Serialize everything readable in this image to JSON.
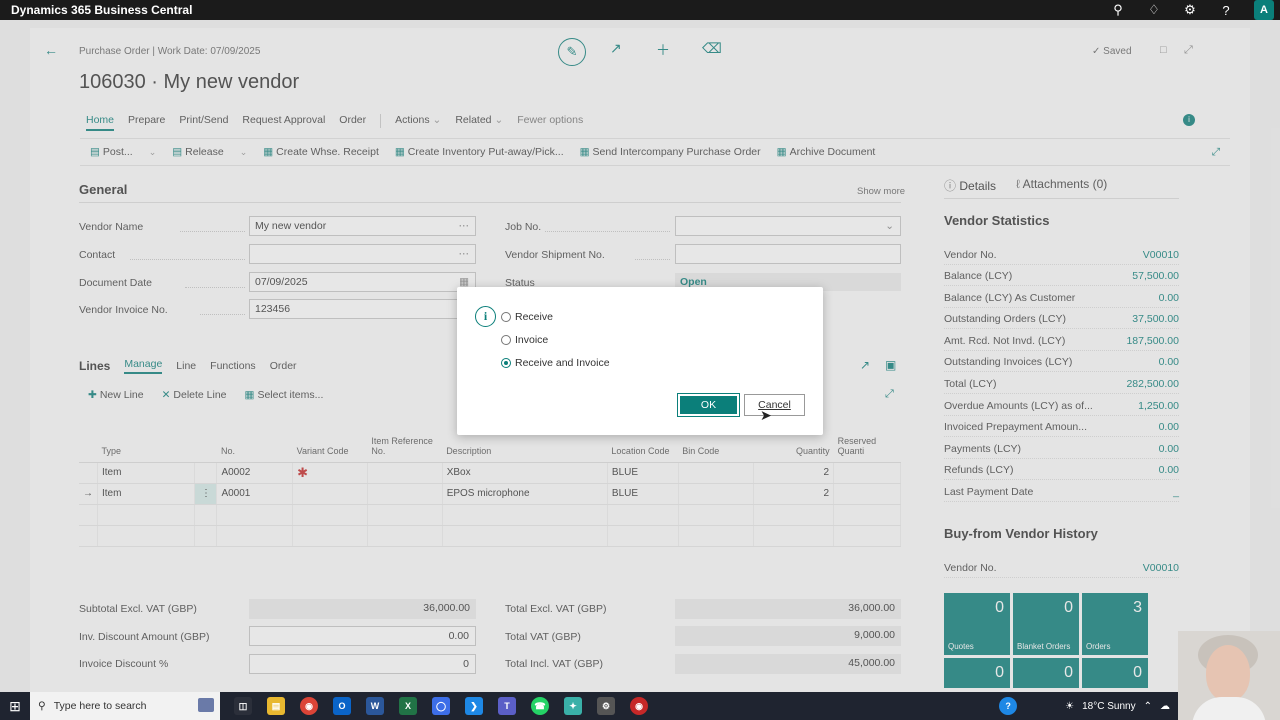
{
  "appbar": {
    "brand": "Dynamics 365 Business Central",
    "avatar": "A"
  },
  "header": {
    "breadcrumb": "Purchase Order | Work Date: 07/09/2025",
    "title": "106030 · My new vendor",
    "saved": "Saved"
  },
  "menu": {
    "items": [
      "Home",
      "Prepare",
      "Print/Send",
      "Request Approval",
      "Order",
      "Actions",
      "Related",
      "Fewer options"
    ]
  },
  "actions": {
    "post": "Post...",
    "release": "Release",
    "create_whse_receipt": "Create Whse. Receipt",
    "create_inventory": "Create Inventory Put-away/Pick...",
    "send_intercompany": "Send Intercompany Purchase Order",
    "archive": "Archive Document"
  },
  "general": {
    "title": "General",
    "show_more": "Show more",
    "vendor_name_label": "Vendor Name",
    "vendor_name": "My new vendor",
    "contact_label": "Contact",
    "contact": "",
    "document_date_label": "Document Date",
    "document_date": "07/09/2025",
    "vendor_invoice_no_label": "Vendor Invoice No.",
    "vendor_invoice_no": "123456",
    "job_no_label": "Job No.",
    "vendor_shipment_no_label": "Vendor Shipment No.",
    "status_label": "Status",
    "status": "Open"
  },
  "lines": {
    "title": "Lines",
    "tabs": [
      "Manage",
      "Line",
      "Functions",
      "Order"
    ],
    "new_line": "New Line",
    "delete_line": "Delete Line",
    "select_items": "Select items...",
    "columns": [
      "Type",
      "No.",
      "Variant Code",
      "Item Reference No.",
      "Description",
      "Location Code",
      "Bin Code",
      "Quantity",
      "Reserved Quanti"
    ],
    "rows": [
      {
        "type": "Item",
        "no": "A0002",
        "description": "XBox",
        "location": "BLUE",
        "quantity": "2"
      },
      {
        "type": "Item",
        "no": "A0001",
        "description": "EPOS microphone",
        "location": "BLUE",
        "quantity": "2"
      }
    ]
  },
  "totals": {
    "subtotal_label": "Subtotal Excl. VAT (GBP)",
    "subtotal": "36,000.00",
    "inv_discount_label": "Inv. Discount Amount (GBP)",
    "inv_discount": "0.00",
    "invoice_discount_pct_label": "Invoice Discount %",
    "invoice_discount_pct": "0",
    "total_excl_label": "Total Excl. VAT (GBP)",
    "total_excl": "36,000.00",
    "total_vat_label": "Total VAT (GBP)",
    "total_vat": "9,000.00",
    "total_incl_label": "Total Incl. VAT (GBP)",
    "total_incl": "45,000.00"
  },
  "factbox": {
    "tab_details": "Details",
    "tab_attachments": "Attachments (0)",
    "stats_title": "Vendor Statistics",
    "stats": [
      {
        "label": "Vendor No.",
        "value": "V00010"
      },
      {
        "label": "Balance (LCY)",
        "value": "57,500.00"
      },
      {
        "label": "Balance (LCY) As Customer",
        "value": "0.00"
      },
      {
        "label": "Outstanding Orders (LCY)",
        "value": "37,500.00"
      },
      {
        "label": "Amt. Rcd. Not Invd. (LCY)",
        "value": "187,500.00"
      },
      {
        "label": "Outstanding Invoices (LCY)",
        "value": "0.00"
      },
      {
        "label": "Total (LCY)",
        "value": "282,500.00"
      },
      {
        "label": "Overdue Amounts (LCY) as of...",
        "value": "1,250.00"
      },
      {
        "label": "Invoiced Prepayment Amoun...",
        "value": "0.00"
      },
      {
        "label": "Payments (LCY)",
        "value": "0.00"
      },
      {
        "label": "Refunds (LCY)",
        "value": "0.00"
      },
      {
        "label": "Last Payment Date",
        "value": "_"
      }
    ],
    "history_title": "Buy-from Vendor History",
    "history_vendor_label": "Vendor No.",
    "history_vendor": "V00010",
    "tiles": [
      {
        "count": "0",
        "label": "Quotes"
      },
      {
        "count": "0",
        "label": "Blanket Orders"
      },
      {
        "count": "3",
        "label": "Orders"
      },
      {
        "count": "0",
        "label": ""
      },
      {
        "count": "0",
        "label": ""
      },
      {
        "count": "0",
        "label": ""
      }
    ]
  },
  "dialog": {
    "options": [
      "Receive",
      "Invoice",
      "Receive and Invoice"
    ],
    "selected": "Receive and Invoice",
    "ok": "OK",
    "cancel": "Cancel"
  },
  "taskbar": {
    "search_placeholder": "Type here to search",
    "weather": "18°C  Sunny"
  },
  "colors": {
    "accent": "#0b7f7a",
    "appbar": "#1b1b1b",
    "required": "#c62828"
  }
}
